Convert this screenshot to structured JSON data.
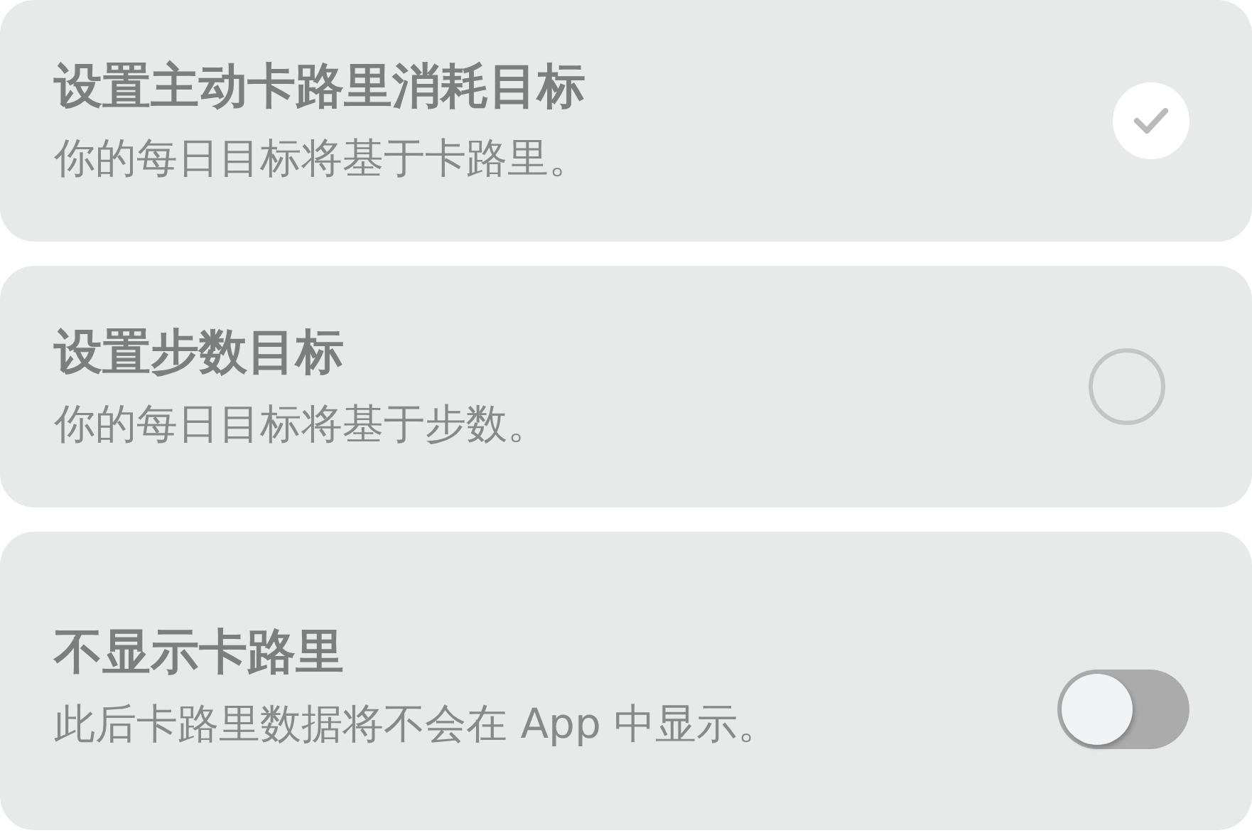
{
  "options": [
    {
      "kind": "radio",
      "title": "设置主动卡路里消耗目标",
      "subtitle": "你的每日目标将基于卡路里。",
      "selected": true
    },
    {
      "kind": "radio",
      "title": "设置步数目标",
      "subtitle": "你的每日目标将基于步数。",
      "selected": false
    },
    {
      "kind": "toggle",
      "title": "不显示卡路里",
      "subtitle": "此后卡路里数据将不会在 App 中显示。",
      "on": false
    }
  ]
}
